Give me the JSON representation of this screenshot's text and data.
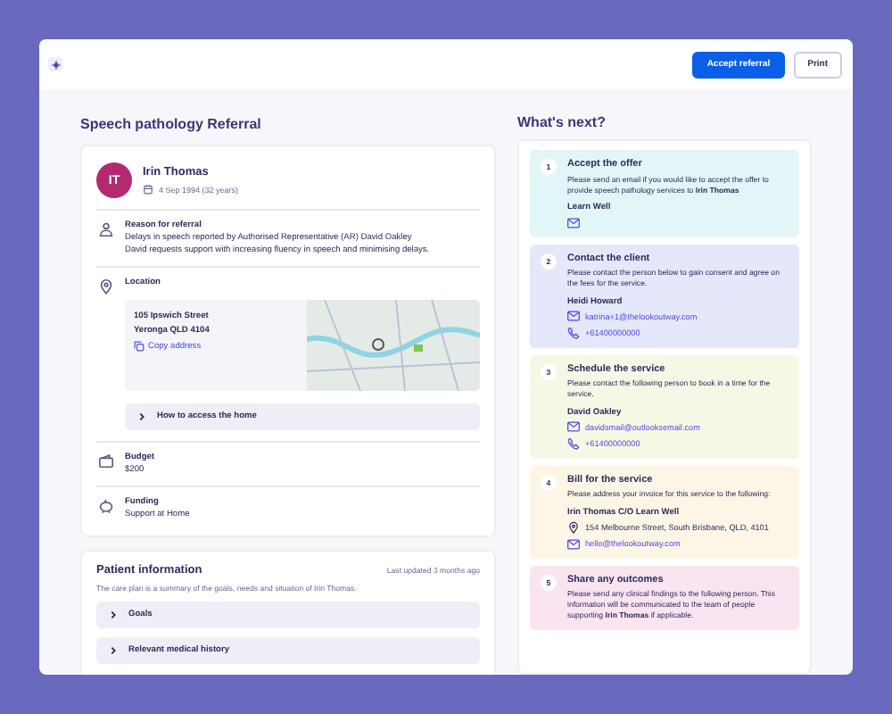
{
  "header": {
    "buttons": [
      {
        "label": "Accept referral",
        "kind": "primary"
      },
      {
        "label": "Print",
        "kind": "secondary"
      }
    ]
  },
  "referral": {
    "title": "Speech pathology Referral",
    "patient": {
      "initials": "IT",
      "name": "Irin Thomas",
      "dob": "4 Sep 1994 (32 years)"
    },
    "reason": {
      "label": "Reason for referral",
      "lines": [
        "Delays in speech reported by Authorised Representative (AR) David Oakley",
        "David requests support with increasing fluency in speech and minimising delays."
      ]
    },
    "location": {
      "label": "Location",
      "address": [
        "105 Ipswich Street",
        "Yeronga QLD 4104"
      ],
      "copy": "Copy address",
      "access": "How to access the home"
    },
    "budget": {
      "label": "Budget",
      "value": "$200"
    },
    "funding": {
      "label": "Funding",
      "value": "Support at Home"
    }
  },
  "patient_information": {
    "title": "Patient information",
    "updated": "Last updated 3 months ago",
    "summary": "The care plan is a summary of the goals, needs and situation of Irin Thomas.",
    "sections": [
      {
        "label": "Goals",
        "expanded": false
      },
      {
        "label": "Relevant medical history",
        "expanded": false
      }
    ]
  },
  "whats_next": {
    "title": "What's next?",
    "steps": [
      {
        "number": "1",
        "title": "Accept the offer",
        "text": "Please send an email if you would like to accept the offer to provide speech pathology services to **Irin Thomas**",
        "color": "#e3f6f7",
        "contact": "Learn Well",
        "details": [
          {
            "kind": "email"
          }
        ]
      },
      {
        "number": "2",
        "title": "Contact the client",
        "text": "Please contact the person below to gain consent and agree on the fees for the service.",
        "color": "#e5e7fb",
        "contact": "Heidi Howard",
        "details": [
          {
            "kind": "email",
            "text": "katrina+1@thelookoutway.com"
          },
          {
            "kind": "phone",
            "text": "+61400000000"
          }
        ]
      },
      {
        "number": "3",
        "title": "Schedule the service",
        "text": "Please contact the following person to book in a time for the service.",
        "color": "#f6f8e6",
        "contact": "David Oakley",
        "details": [
          {
            "kind": "email",
            "text": "davidsmail@outlooksemail.com"
          },
          {
            "kind": "phone",
            "text": "+61400000000"
          }
        ]
      },
      {
        "number": "4",
        "title": "Bill for the service",
        "text": "Please address your invoice for this service to the following:",
        "color": "#fdf6e6",
        "contact": "Irin Thomas C/O Learn Well",
        "details": [
          {
            "kind": "address",
            "text": "154 Melbourne Street, South Brisbane, QLD, 4101"
          },
          {
            "kind": "email",
            "text": "hello@thelookoutway.com"
          }
        ]
      },
      {
        "number": "5",
        "title": "Share any outcomes",
        "text": "Please send any clinical findings to the following person. This information will be communicated to the team of people supporting **Irin Thomas** if applicable.",
        "color": "#f9e4f0"
      }
    ]
  }
}
